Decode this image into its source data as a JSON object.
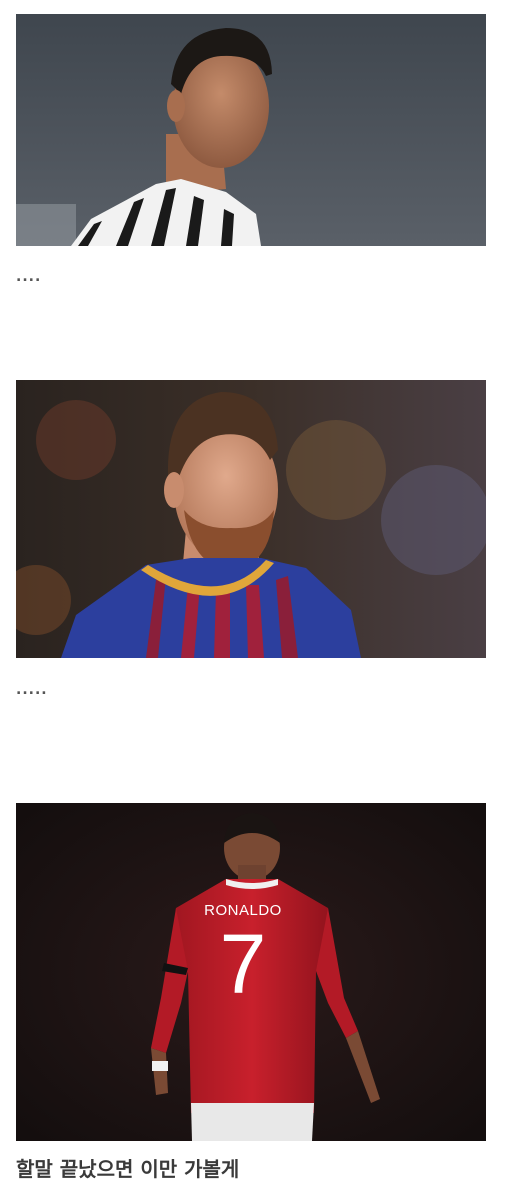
{
  "post": {
    "images": [
      {
        "name": "photo-ronaldo-juventus",
        "subject": "Player in black-and-white striped jersey"
      },
      {
        "name": "photo-messi-barcelona",
        "subject": "Bearded player in blue and claret striped jersey"
      },
      {
        "name": "photo-ronaldo-united-back",
        "subject": "Player seen from behind in red number 7 jersey",
        "jersey_name": "RONALDO",
        "jersey_number": "7"
      }
    ],
    "ellipsis_1": "....",
    "ellipsis_2": ".....",
    "caption": "할말 끝났으면 이만 가볼게"
  },
  "colors": {
    "background": "#ffffff",
    "text": "#3a3a3a"
  }
}
